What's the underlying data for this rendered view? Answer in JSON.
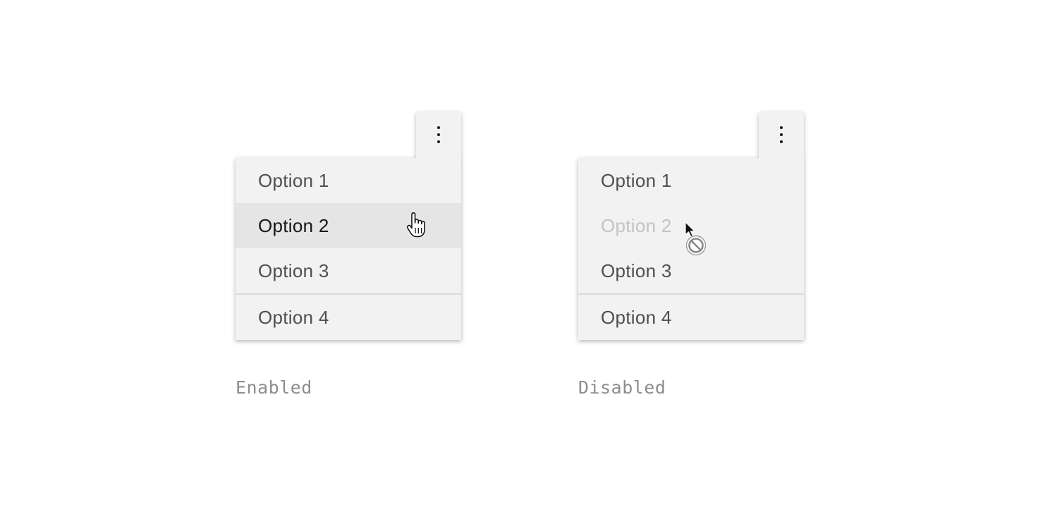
{
  "examples": [
    {
      "state": "enabled",
      "caption": "Enabled",
      "trigger_icon": "overflow-menu-vertical-icon",
      "options": [
        "Option 1",
        "Option 2",
        "Option 3",
        "Option 4"
      ],
      "hovered_option": "Option 2",
      "cursor_icon": "hand-pointer-cursor-icon"
    },
    {
      "state": "disabled",
      "caption": "Disabled",
      "trigger_icon": "overflow-menu-vertical-icon",
      "options": [
        "Option 1",
        "Option 2",
        "Option 3",
        "Option 4"
      ],
      "disabled_option": "Option 2",
      "cursor_icon": "not-allowed-cursor-icon"
    }
  ],
  "colors": {
    "menu_background": "#f2f2f2",
    "hover_background": "#e5e5e5",
    "text": "#4f4f4f",
    "text_hover": "#161616",
    "text_disabled": "#c3c3c3",
    "divider": "#dcdcdc",
    "caption": "#8d8d8d"
  }
}
